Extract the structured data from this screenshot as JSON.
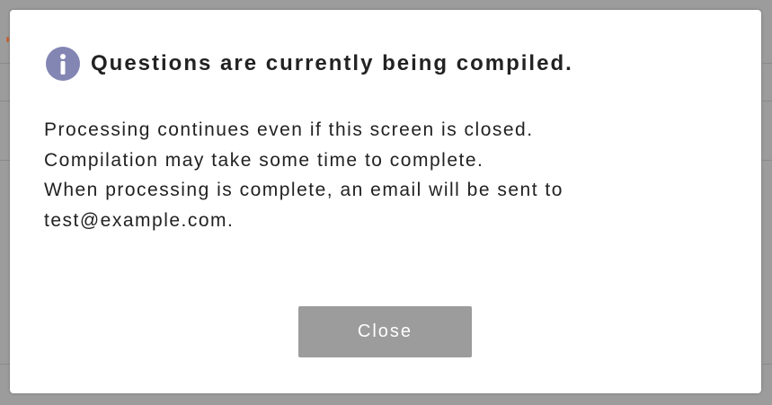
{
  "dialog": {
    "icon": "info-icon",
    "title": "Questions are currently being compiled.",
    "message_lines": [
      "Processing continues even if this screen is closed.",
      "Compilation may take some time to complete.",
      "When processing is complete, an email will be sent to",
      "test@example.com."
    ],
    "close_label": "Close"
  },
  "colors": {
    "overlay": "#9c9c9c",
    "icon_bg": "#8386b3",
    "button_bg": "#9c9c9c",
    "text": "#222222"
  }
}
